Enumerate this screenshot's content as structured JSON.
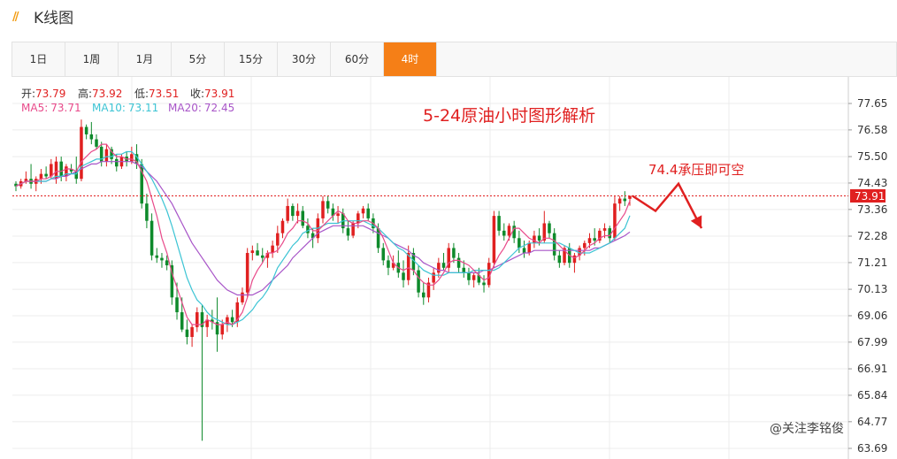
{
  "header": {
    "title": "K线图",
    "icon": "double-slash-bars-icon"
  },
  "tabs": [
    {
      "label": "1日",
      "active": false
    },
    {
      "label": "1周",
      "active": false
    },
    {
      "label": "1月",
      "active": false
    },
    {
      "label": "5分",
      "active": false
    },
    {
      "label": "15分",
      "active": false
    },
    {
      "label": "30分",
      "active": false
    },
    {
      "label": "60分",
      "active": false
    },
    {
      "label": "4时",
      "active": true
    }
  ],
  "info": {
    "open_label": "开:",
    "open": "73.79",
    "high_label": "高:",
    "high": "73.92",
    "low_label": "低:",
    "low": "73.51",
    "close_label": "收:",
    "close": "73.91",
    "ma5_label": "MA5:",
    "ma5": "73.71",
    "ma10_label": "MA10:",
    "ma10": "73.11",
    "ma20_label": "MA20:",
    "ma20": "72.45"
  },
  "watermark": "@关注李铭俊",
  "colors": {
    "up": "#e02020",
    "down": "#0e8a2b",
    "ma5": "#e84a8a",
    "ma10": "#3cc4d4",
    "ma20": "#a855c8",
    "annotation": "#e02020",
    "price_tag": "#e02020",
    "accent_tab": "#f57f17"
  },
  "chart_data": {
    "type": "candlestick",
    "title": "5-24原油小时图形解析",
    "annotation": "74.4承压即可空",
    "current_price": "73.91",
    "y_ticks": [
      "77.65",
      "76.58",
      "75.50",
      "74.43",
      "73.36",
      "72.28",
      "71.21",
      "70.13",
      "69.06",
      "67.99",
      "66.91",
      "65.84",
      "64.77",
      "63.69"
    ],
    "ylim": [
      63.69,
      77.65
    ],
    "grid": true,
    "candles": [
      [
        74.4,
        74.5,
        74.1,
        74.3
      ],
      [
        74.3,
        74.6,
        74.2,
        74.5
      ],
      [
        74.5,
        74.9,
        74.4,
        74.6
      ],
      [
        74.6,
        75.2,
        74.2,
        74.4
      ],
      [
        74.4,
        74.7,
        74.1,
        74.6
      ],
      [
        74.6,
        75.0,
        74.4,
        74.8
      ],
      [
        74.8,
        75.1,
        74.6,
        74.7
      ],
      [
        74.7,
        75.4,
        74.6,
        75.2
      ],
      [
        74.6,
        75.5,
        74.4,
        75.3
      ],
      [
        75.3,
        75.5,
        74.5,
        74.7
      ],
      [
        74.7,
        75.2,
        74.5,
        75.1
      ],
      [
        75.0,
        75.2,
        74.8,
        74.9
      ],
      [
        74.9,
        75.5,
        74.4,
        74.6
      ],
      [
        74.6,
        77.0,
        74.5,
        76.7
      ],
      [
        76.7,
        76.8,
        76.2,
        76.4
      ],
      [
        76.4,
        76.9,
        76.0,
        76.2
      ],
      [
        76.2,
        76.4,
        75.8,
        75.9
      ],
      [
        75.9,
        76.1,
        75.1,
        75.3
      ],
      [
        75.3,
        76.0,
        75.1,
        75.8
      ],
      [
        75.8,
        75.9,
        75.2,
        75.4
      ],
      [
        75.4,
        75.6,
        74.9,
        75.1
      ],
      [
        75.1,
        75.6,
        75.0,
        75.5
      ],
      [
        75.5,
        75.7,
        75.1,
        75.3
      ],
      [
        75.3,
        75.9,
        75.2,
        75.6
      ],
      [
        75.6,
        76.0,
        75.0,
        75.2
      ],
      [
        75.2,
        75.4,
        73.4,
        73.6
      ],
      [
        73.6,
        74.0,
        72.6,
        72.9
      ],
      [
        72.9,
        73.2,
        71.3,
        71.5
      ],
      [
        71.5,
        71.8,
        71.2,
        71.4
      ],
      [
        71.4,
        71.6,
        71.0,
        71.3
      ],
      [
        71.3,
        71.5,
        70.9,
        71.1
      ],
      [
        71.1,
        71.3,
        69.5,
        69.8
      ],
      [
        69.8,
        70.4,
        68.9,
        69.2
      ],
      [
        69.2,
        69.8,
        68.4,
        68.5
      ],
      [
        68.5,
        68.9,
        67.9,
        68.2
      ],
      [
        68.2,
        68.7,
        67.8,
        68.6
      ],
      [
        68.6,
        69.4,
        68.4,
        69.2
      ],
      [
        69.2,
        69.5,
        64.0,
        68.6
      ],
      [
        68.6,
        69.1,
        68.2,
        68.9
      ],
      [
        68.9,
        69.3,
        68.5,
        68.8
      ],
      [
        68.8,
        69.8,
        67.6,
        68.3
      ],
      [
        68.3,
        68.9,
        68.1,
        68.7
      ],
      [
        68.7,
        69.1,
        68.4,
        69.0
      ],
      [
        69.0,
        69.3,
        68.6,
        68.8
      ],
      [
        68.8,
        69.8,
        68.6,
        69.6
      ],
      [
        69.6,
        70.2,
        69.5,
        70.0
      ],
      [
        70.0,
        71.8,
        69.8,
        71.6
      ],
      [
        71.6,
        71.9,
        71.3,
        71.7
      ],
      [
        71.7,
        72.0,
        71.5,
        71.5
      ],
      [
        71.5,
        71.8,
        71.2,
        71.4
      ],
      [
        71.4,
        71.7,
        71.0,
        71.6
      ],
      [
        71.6,
        72.1,
        71.4,
        71.9
      ],
      [
        71.9,
        72.7,
        71.6,
        72.4
      ],
      [
        72.4,
        73.0,
        72.2,
        72.9
      ],
      [
        72.9,
        73.8,
        72.8,
        73.5
      ],
      [
        73.5,
        73.6,
        72.9,
        73.1
      ],
      [
        73.1,
        73.6,
        72.8,
        73.3
      ],
      [
        73.3,
        73.5,
        72.6,
        72.7
      ],
      [
        72.7,
        73.0,
        72.2,
        72.4
      ],
      [
        72.4,
        72.6,
        71.8,
        72.2
      ],
      [
        72.2,
        73.2,
        72.0,
        73.0
      ],
      [
        73.0,
        73.9,
        72.8,
        73.7
      ],
      [
        73.7,
        73.9,
        73.2,
        73.4
      ],
      [
        73.4,
        73.6,
        72.9,
        73.1
      ],
      [
        73.1,
        73.5,
        72.8,
        73.2
      ],
      [
        73.2,
        73.4,
        72.4,
        72.6
      ],
      [
        72.6,
        72.9,
        72.1,
        72.3
      ],
      [
        72.3,
        72.9,
        72.2,
        72.8
      ],
      [
        72.8,
        73.3,
        72.6,
        73.2
      ],
      [
        73.2,
        73.5,
        73.0,
        73.4
      ],
      [
        73.4,
        73.6,
        72.9,
        73.0
      ],
      [
        73.0,
        73.2,
        72.4,
        72.6
      ],
      [
        72.6,
        72.8,
        71.6,
        71.8
      ],
      [
        71.8,
        72.0,
        71.1,
        71.3
      ],
      [
        71.3,
        71.5,
        70.7,
        71.0
      ],
      [
        71.0,
        71.5,
        70.9,
        71.2
      ],
      [
        71.2,
        71.7,
        70.6,
        70.8
      ],
      [
        70.8,
        71.3,
        70.2,
        70.5
      ],
      [
        70.5,
        71.9,
        70.3,
        71.6
      ],
      [
        71.6,
        71.8,
        70.7,
        70.9
      ],
      [
        70.9,
        71.1,
        69.8,
        70.0
      ],
      [
        70.0,
        70.4,
        69.5,
        69.8
      ],
      [
        69.8,
        70.6,
        69.6,
        70.4
      ],
      [
        70.4,
        71.0,
        70.1,
        70.8
      ],
      [
        70.8,
        71.4,
        70.6,
        71.2
      ],
      [
        71.2,
        71.6,
        70.9,
        71.0
      ],
      [
        71.0,
        72.0,
        70.8,
        71.8
      ],
      [
        71.8,
        72.0,
        71.2,
        71.4
      ],
      [
        71.4,
        71.6,
        70.8,
        71.0
      ],
      [
        71.0,
        71.3,
        70.6,
        70.8
      ],
      [
        70.8,
        71.0,
        70.3,
        70.5
      ],
      [
        70.5,
        70.8,
        70.2,
        70.7
      ],
      [
        70.7,
        71.0,
        70.3,
        70.4
      ],
      [
        70.4,
        70.7,
        70.0,
        70.3
      ],
      [
        70.3,
        71.4,
        70.2,
        71.2
      ],
      [
        71.2,
        73.3,
        71.0,
        73.1
      ],
      [
        73.1,
        73.3,
        72.3,
        72.5
      ],
      [
        72.5,
        72.8,
        72.1,
        72.3
      ],
      [
        72.3,
        72.8,
        72.1,
        72.7
      ],
      [
        72.7,
        72.9,
        72.0,
        72.2
      ],
      [
        72.2,
        72.5,
        71.6,
        71.8
      ],
      [
        71.8,
        72.1,
        71.4,
        71.6
      ],
      [
        71.6,
        72.1,
        71.5,
        72.0
      ],
      [
        72.0,
        72.5,
        71.8,
        72.3
      ],
      [
        72.3,
        72.6,
        71.9,
        72.1
      ],
      [
        72.1,
        73.3,
        72.0,
        72.8
      ],
      [
        72.8,
        72.9,
        72.2,
        72.4
      ],
      [
        72.4,
        72.6,
        71.3,
        71.5
      ],
      [
        71.5,
        71.7,
        71.0,
        71.2
      ],
      [
        71.2,
        71.9,
        71.1,
        71.8
      ],
      [
        71.8,
        72.0,
        71.0,
        71.2
      ],
      [
        71.2,
        71.6,
        70.8,
        71.5
      ],
      [
        71.5,
        71.9,
        71.3,
        71.8
      ],
      [
        71.8,
        72.1,
        71.5,
        72.0
      ],
      [
        72.0,
        72.4,
        71.8,
        72.2
      ],
      [
        72.2,
        72.6,
        71.9,
        72.1
      ],
      [
        72.1,
        72.6,
        72.0,
        72.5
      ],
      [
        72.5,
        72.8,
        72.2,
        72.6
      ],
      [
        72.6,
        72.7,
        72.0,
        72.2
      ],
      [
        72.2,
        73.9,
        72.1,
        73.6
      ],
      [
        73.6,
        73.9,
        73.3,
        73.8
      ],
      [
        73.8,
        74.1,
        73.5,
        73.7
      ],
      [
        73.79,
        73.92,
        73.51,
        73.91
      ]
    ],
    "ma5": [
      74.3,
      74.4,
      74.5,
      74.5,
      74.5,
      74.6,
      74.6,
      74.7,
      74.9,
      74.9,
      75.0,
      75.0,
      74.9,
      75.3,
      75.5,
      75.7,
      75.8,
      76.0,
      76.0,
      75.7,
      75.5,
      75.5,
      75.4,
      75.4,
      75.3,
      74.9,
      74.5,
      73.8,
      73.1,
      72.2,
      71.6,
      70.8,
      70.2,
      69.6,
      69.0,
      68.7,
      68.7,
      68.7,
      68.9,
      68.8,
      68.7,
      68.7,
      68.8,
      68.7,
      68.9,
      69.2,
      69.8,
      70.5,
      70.9,
      71.2,
      71.6,
      71.6,
      71.7,
      72.0,
      72.4,
      72.6,
      72.9,
      72.9,
      72.8,
      72.5,
      72.5,
      72.7,
      72.9,
      73.1,
      73.3,
      73.2,
      72.9,
      72.8,
      72.8,
      72.9,
      72.9,
      72.8,
      72.6,
      72.2,
      71.7,
      71.2,
      71.0,
      70.9,
      71.0,
      70.9,
      70.6,
      70.4,
      70.3,
      70.3,
      70.5,
      70.8,
      71.2,
      71.3,
      71.3,
      71.2,
      71.1,
      70.9,
      70.7,
      70.5,
      70.6,
      71.1,
      71.5,
      71.8,
      72.2,
      72.6,
      72.6,
      72.4,
      72.2,
      72.1,
      72.0,
      72.2,
      72.2,
      72.1,
      71.9,
      71.7,
      71.5,
      71.4,
      71.5,
      71.7,
      71.9,
      72.0,
      72.2,
      72.3,
      72.3,
      72.6,
      72.9,
      73.2,
      73.71
    ],
    "ma10": [
      74.3,
      74.4,
      74.5,
      74.5,
      74.5,
      74.5,
      74.5,
      74.6,
      74.7,
      74.7,
      74.8,
      74.8,
      74.8,
      75.1,
      75.2,
      75.3,
      75.4,
      75.4,
      75.5,
      75.5,
      75.6,
      75.6,
      75.7,
      75.7,
      75.5,
      75.2,
      74.9,
      74.6,
      74.2,
      73.8,
      73.3,
      72.7,
      72.0,
      71.3,
      70.6,
      70.1,
      69.7,
      69.5,
      69.2,
      69.0,
      68.9,
      68.8,
      68.7,
      68.7,
      68.8,
      68.9,
      69.1,
      69.3,
      69.6,
      69.8,
      70.1,
      70.5,
      71.0,
      71.3,
      71.6,
      71.9,
      72.1,
      72.4,
      72.5,
      72.6,
      72.6,
      72.7,
      72.8,
      72.8,
      72.8,
      72.9,
      72.9,
      72.9,
      72.9,
      72.9,
      72.8,
      72.7,
      72.6,
      72.4,
      72.2,
      72.0,
      71.8,
      71.7,
      71.5,
      71.3,
      71.1,
      70.9,
      70.8,
      70.7,
      70.7,
      70.7,
      70.8,
      70.8,
      70.8,
      70.8,
      70.8,
      70.9,
      70.9,
      70.9,
      70.9,
      70.9,
      71.0,
      71.2,
      71.4,
      71.6,
      71.8,
      71.9,
      72.0,
      72.0,
      72.0,
      72.0,
      72.0,
      72.0,
      72.0,
      71.9,
      71.8,
      71.7,
      71.6,
      71.6,
      71.6,
      71.7,
      71.8,
      71.9,
      72.0,
      72.2,
      72.4,
      72.6,
      73.11
    ],
    "ma20": [
      74.3,
      74.4,
      74.5,
      74.5,
      74.5,
      74.5,
      74.5,
      74.6,
      74.6,
      74.7,
      74.7,
      74.8,
      74.9,
      75.0,
      75.1,
      75.2,
      75.2,
      75.3,
      75.3,
      75.3,
      75.3,
      75.3,
      75.3,
      75.3,
      75.2,
      75.1,
      74.9,
      74.7,
      74.5,
      74.2,
      73.9,
      73.6,
      73.2,
      72.8,
      72.4,
      72.0,
      71.7,
      71.4,
      71.1,
      70.8,
      70.5,
      70.3,
      70.1,
      70.0,
      69.9,
      69.9,
      69.9,
      69.9,
      70.0,
      70.1,
      70.3,
      70.5,
      70.7,
      70.9,
      71.1,
      71.4,
      71.6,
      71.8,
      72.0,
      72.2,
      72.4,
      72.5,
      72.6,
      72.7,
      72.7,
      72.7,
      72.7,
      72.7,
      72.7,
      72.7,
      72.6,
      72.5,
      72.4,
      72.3,
      72.2,
      72.0,
      71.9,
      71.8,
      71.7,
      71.5,
      71.4,
      71.2,
      71.1,
      71.0,
      70.9,
      70.9,
      70.8,
      70.8,
      70.8,
      70.8,
      70.8,
      70.8,
      70.8,
      70.9,
      70.9,
      71.0,
      71.1,
      71.2,
      71.3,
      71.4,
      71.5,
      71.6,
      71.6,
      71.7,
      71.7,
      71.7,
      71.7,
      71.7,
      71.7,
      71.7,
      71.7,
      71.7,
      71.7,
      71.7,
      71.7,
      71.8,
      71.8,
      71.9,
      72.0,
      72.1,
      72.2,
      72.3,
      72.45
    ],
    "arrow_path": [
      [
        73.91,
        0
      ],
      [
        73.3,
        1
      ],
      [
        74.4,
        2
      ],
      [
        72.6,
        3
      ]
    ]
  }
}
